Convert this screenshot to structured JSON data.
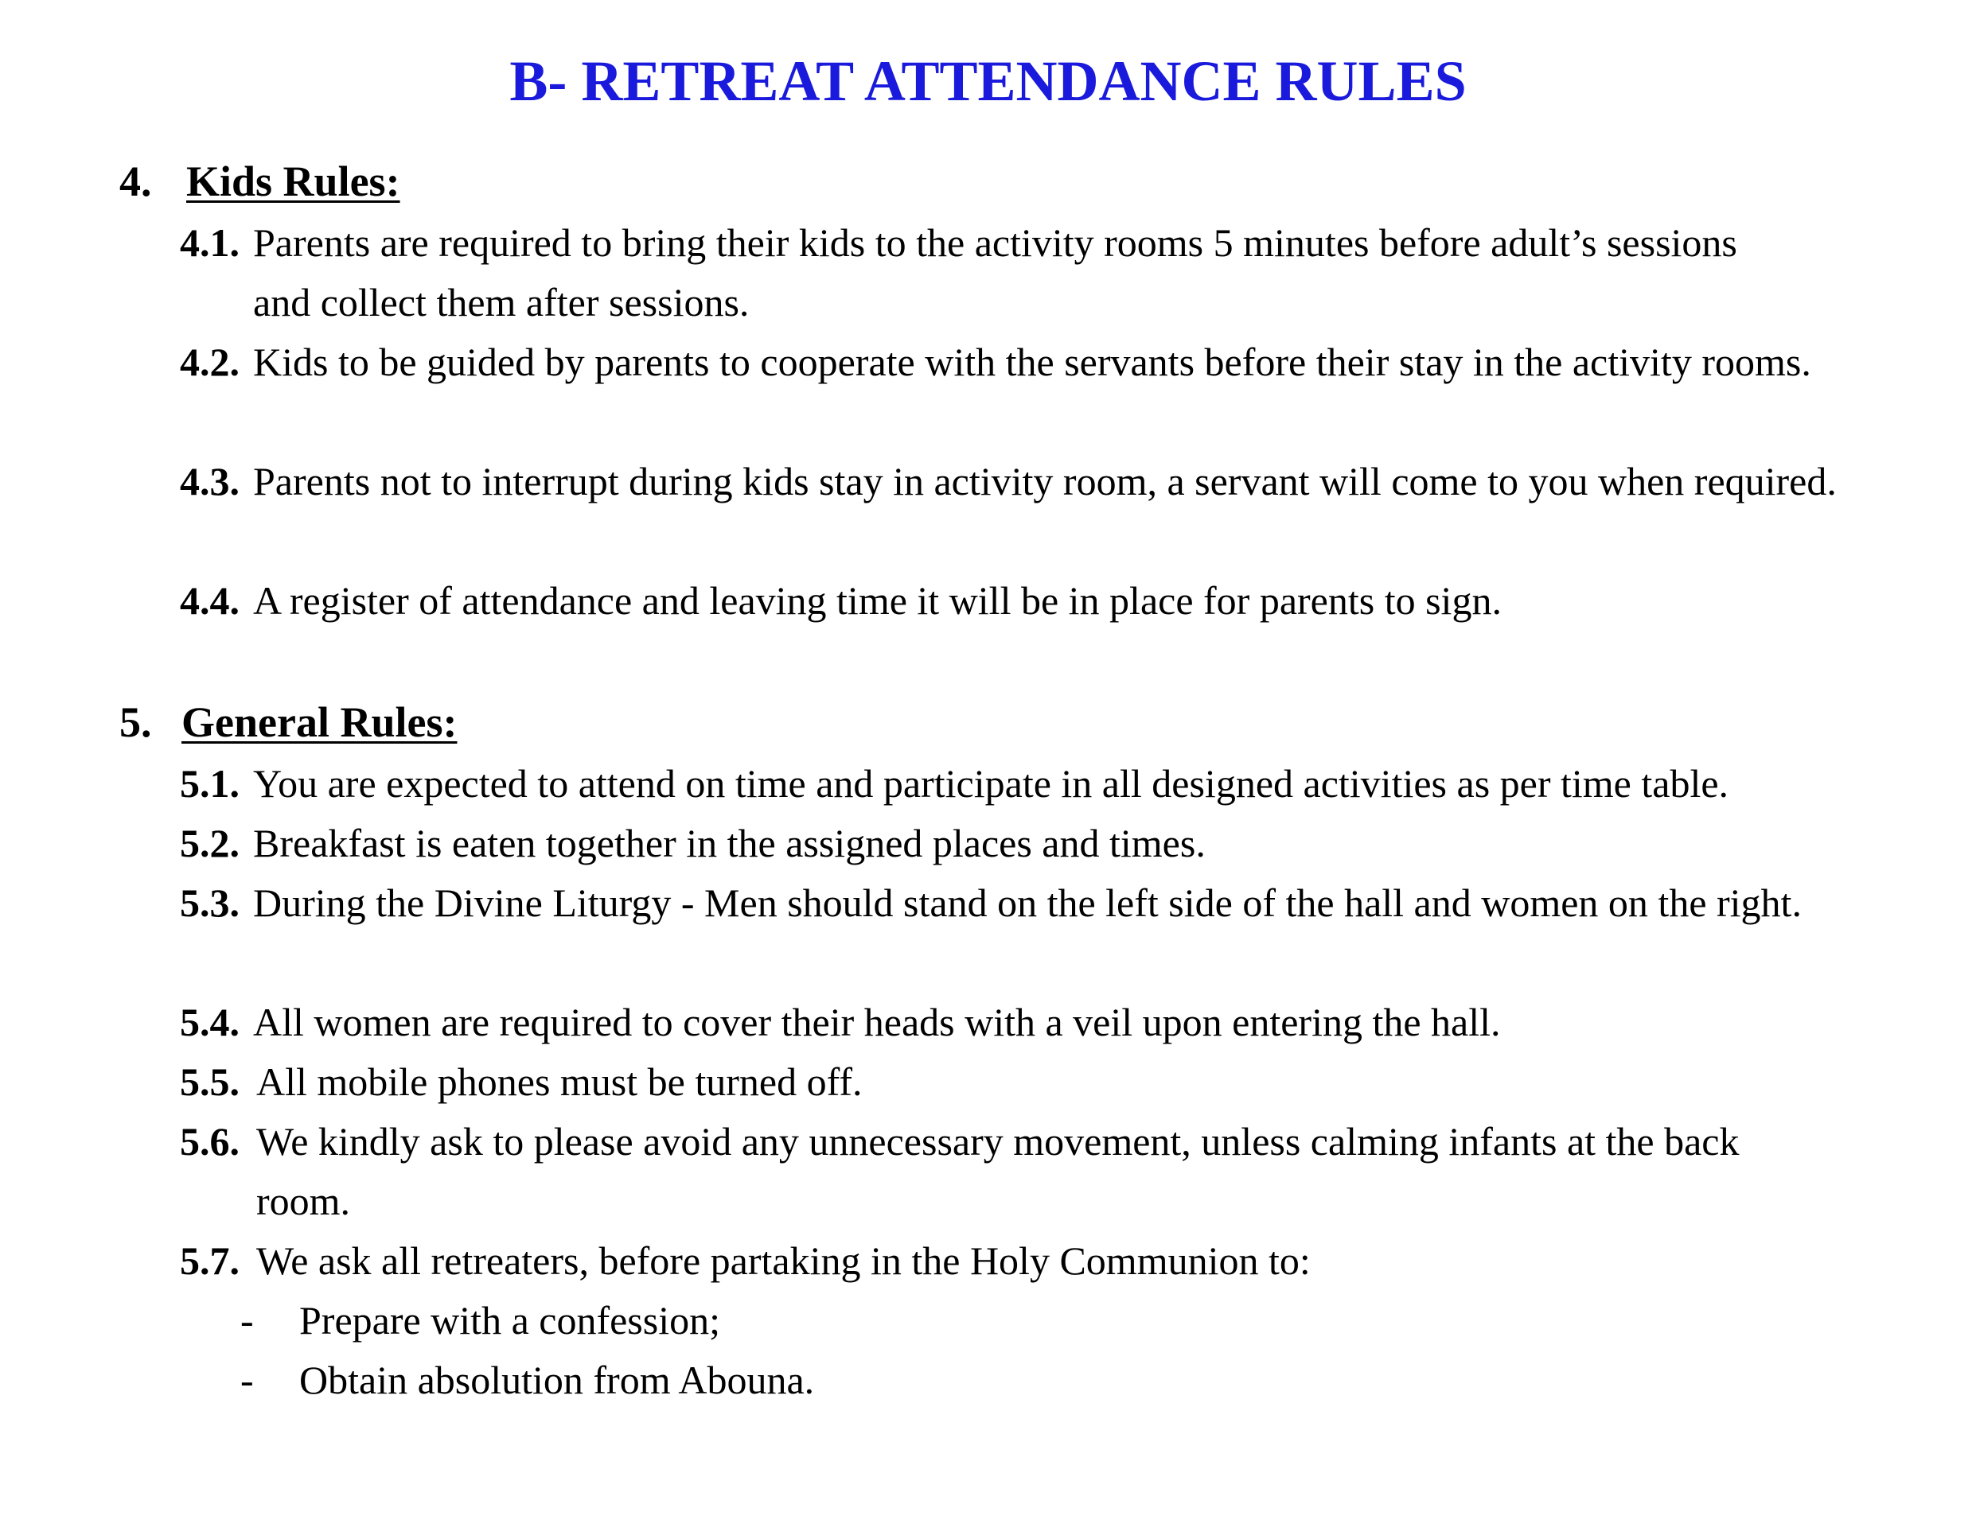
{
  "document": {
    "title": "B- RETREAT ATTENDANCE RULES",
    "title_color": "#1a1adc"
  },
  "sections": [
    {
      "number": "4.",
      "title": "Kids Rules:",
      "rules": [
        {
          "number": "4.1.",
          "text": "Parents are required to bring their kids to the activity rooms 5 minutes before adult’s sessions and collect them after sessions."
        },
        {
          "number": "4.2.",
          "text": "Kids to be guided by parents to cooperate with the servants before their stay in the activity rooms."
        },
        {
          "number": "4.3.",
          "text": "Parents not to interrupt during kids stay in activity room, a servant will come to you when required."
        },
        {
          "number": "4.4.",
          "text": "A register of attendance and leaving time it will be in place for parents to sign."
        }
      ]
    },
    {
      "number": "5.",
      "title": "General Rules:",
      "rules": [
        {
          "number": "5.1.",
          "text": "You are expected to attend on time and participate in all designed activities as per time table."
        },
        {
          "number": "5.2.",
          "text": "Breakfast is eaten together in the assigned places and times."
        },
        {
          "number": "5.3.",
          "text": "During the Divine Liturgy - Men should stand on the left side of the hall and women on the right."
        },
        {
          "number": "5.4.",
          "text": "All women are required to cover their heads with a veil upon entering the hall."
        },
        {
          "number": "5.5.",
          "text": "All mobile phones must be turned off."
        },
        {
          "number": "5.6.",
          "text": "We kindly ask to please avoid any unnecessary movement, unless calming infants at the back room."
        },
        {
          "number": "5.7.",
          "text": "We ask all retreaters, before partaking in the Holy Communion to:"
        }
      ],
      "sub_items": [
        {
          "marker": "-",
          "text": "Prepare with a confession;"
        },
        {
          "marker": "-",
          "text": "Obtain absolution from Abouna."
        }
      ]
    }
  ]
}
